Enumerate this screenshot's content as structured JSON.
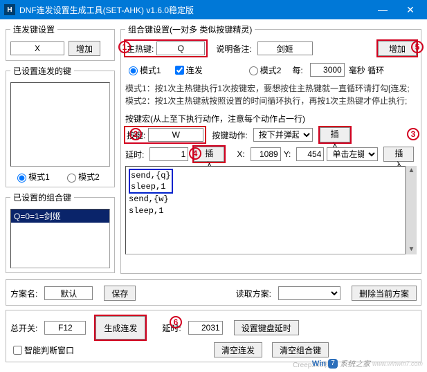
{
  "window": {
    "icon_letter": "H",
    "title": "DNF连发设置生成工具(SET-AHK) v1.6.0稳定版",
    "min": "—",
    "close": "✕"
  },
  "left": {
    "group1_title": "连发键设置",
    "key_value": "X",
    "add_label": "增加",
    "group2_title": "已设置连发的键",
    "mode1_label": "模式1",
    "mode2_label": "模式2",
    "group3_title": "已设置的组合键",
    "combo_item": "Q=0=1=剑姬"
  },
  "right": {
    "group_title": "组合键设置(一对多 类似按键精灵)",
    "main_hotkey_label": "主热键:",
    "main_hotkey_value": "Q",
    "note_label": "说明备注:",
    "note_value": "剑姬",
    "add_label": "增加",
    "mode1_label": "模式1",
    "repeat_label": "连发",
    "mode2_label": "模式2",
    "every_label": "每:",
    "every_value": "3000",
    "every_unit": "毫秒 循环",
    "desc1": "模式1：按1次主热键执行1次按键宏，要想按住主热键就一直循环请打勾[连发;",
    "desc2": "模式2：按1次主热键就按照设置的时间循环执行，再按1次主热键才停止执行;",
    "macro_title": "按键宏(从上至下执行动作，注意每个动作占一行)",
    "key_label": "按键:",
    "key_value": "W",
    "key_action_label": "按键动作:",
    "key_action_value": "按下并弹起",
    "insert1_label": "插入",
    "delay_label": "延时:",
    "delay_value": "1",
    "insert2_label": "插入",
    "x_label": "X:",
    "x_value": "1089",
    "y_label": "Y:",
    "y_value": "454",
    "mouse_action_value": "单击左键",
    "insert3_label": "插入",
    "script_lines": [
      "send,{q}",
      "sleep,1",
      "send,{w}",
      "sleep,1"
    ]
  },
  "bottom1": {
    "scheme_name_label": "方案名:",
    "scheme_name_value": "默认",
    "save_label": "保存",
    "load_label": "读取方案:",
    "delete_label": "删除当前方案"
  },
  "bottom2": {
    "master_label": "总开关:",
    "master_value": "F12",
    "generate_label": "生成连发",
    "delay_label": "延时:",
    "delay_value": "2031",
    "set_kb_delay_label": "设置键盘延时",
    "smart_label": "智能判断窗口",
    "clear_label": "清空连发",
    "clear_combo_label": "清空组合键"
  },
  "annotations": {
    "1": "1",
    "2": "2",
    "3": "3",
    "4": "4",
    "5": "5",
    "6": "6"
  },
  "watermark": {
    "brand": "Win",
    "seven": "7",
    "text": "系统之家",
    "url": "www.winwin7.com"
  },
  "credit": "Creep345制作"
}
